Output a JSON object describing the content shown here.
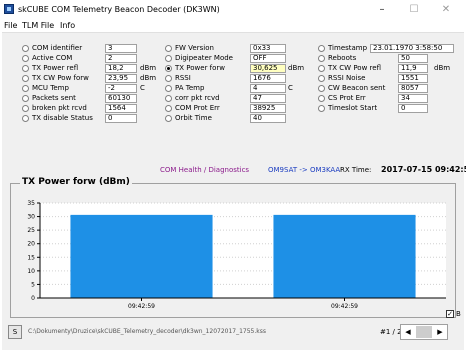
{
  "window": {
    "title": "skCUBE COM Telemetry Beacon Decoder (DK3WN)",
    "min": "–",
    "max": "☐",
    "close": "✕"
  },
  "menu": [
    "File",
    "TLM File",
    "Info"
  ],
  "col1": [
    {
      "label": "COM identifier",
      "value": "3",
      "unit": "",
      "selected": false
    },
    {
      "label": "Active COM",
      "value": "2",
      "unit": "",
      "selected": false
    },
    {
      "label": "TX Power refl",
      "value": "18,2",
      "unit": "dBm",
      "selected": false
    },
    {
      "label": "TX CW Pow forw",
      "value": "23,95",
      "unit": "dBm",
      "selected": false
    },
    {
      "label": "MCU Temp",
      "value": "-2",
      "unit": "C",
      "selected": false
    },
    {
      "label": "Packets sent",
      "value": "60130",
      "unit": "",
      "selected": false
    },
    {
      "label": "broken pkt rcvd",
      "value": "1564",
      "unit": "",
      "selected": false
    },
    {
      "label": "TX disable Status",
      "value": "0",
      "unit": "",
      "selected": false
    }
  ],
  "col2": [
    {
      "label": "FW Version",
      "value": "0x33",
      "unit": "",
      "selected": false
    },
    {
      "label": "Digipeater Mode",
      "value": "OFF",
      "unit": "",
      "selected": false
    },
    {
      "label": "TX Power forw",
      "value": "30,625",
      "unit": "dBm",
      "selected": true,
      "highlight": true
    },
    {
      "label": "RSSI",
      "value": "1676",
      "unit": "",
      "selected": false
    },
    {
      "label": "PA Temp",
      "value": "4",
      "unit": "C",
      "selected": false
    },
    {
      "label": "corr pkt rcvd",
      "value": "47",
      "unit": "",
      "selected": false
    },
    {
      "label": "COM Prot Err",
      "value": "38925",
      "unit": "",
      "selected": false
    },
    {
      "label": "Orbit Time",
      "value": "40",
      "unit": "",
      "selected": false
    }
  ],
  "col3": [
    {
      "label": "Timestamp",
      "value": "23.01.1970 3:58:50",
      "unit": "",
      "selected": false
    },
    {
      "label": "Reboots",
      "value": "50",
      "unit": "",
      "selected": false
    },
    {
      "label": "TX CW Pow refl",
      "value": "11,9",
      "unit": "dBm",
      "selected": false
    },
    {
      "label": "RSSI Noise",
      "value": "1551",
      "unit": "",
      "selected": false
    },
    {
      "label": "CW Beacon sent",
      "value": "8057",
      "unit": "",
      "selected": false
    },
    {
      "label": "CS Prot Err",
      "value": "34",
      "unit": "",
      "selected": false
    },
    {
      "label": "Timeslot Start",
      "value": "0",
      "unit": "",
      "selected": false
    }
  ],
  "status": {
    "section": "COM Health / Diagnostics",
    "route": "OM9SAT -> OM3KAA",
    "rx_label": "RX Time:",
    "rx_time": "2017-07-15 09:42:59"
  },
  "chart_data": {
    "type": "bar",
    "title": "TX Power forw (dBm)",
    "categories": [
      "09:42:59",
      "09:42:59"
    ],
    "values": [
      30.625,
      30.625
    ],
    "ylim": [
      0,
      35
    ],
    "yticks": [
      0,
      5,
      10,
      15,
      20,
      25,
      30,
      35
    ],
    "grid": true,
    "bar_color": "#1e90e6"
  },
  "bottom": {
    "s_button": "S",
    "file_path": "C:\\Dokumenty\\Druzice\\skCUBE_Telemetry_decoder\\dk3wn_12072017_1755.kss",
    "page": "#1 / 2",
    "checkbox_label": "B",
    "checkbox_checked": true
  }
}
